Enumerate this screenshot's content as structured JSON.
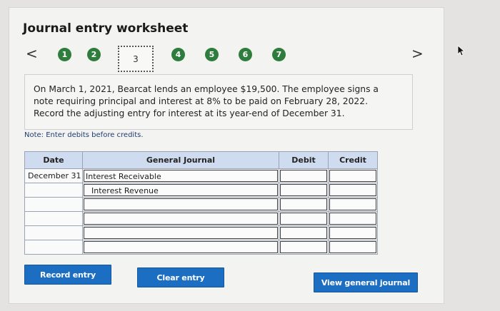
{
  "title": "Journal entry worksheet",
  "nav": {
    "prev_glyph": "<",
    "next_glyph": ">",
    "steps": [
      "1",
      "2",
      "3",
      "4",
      "5",
      "6",
      "7"
    ],
    "current_step": "3"
  },
  "question": {
    "lines": [
      "On March 1, 2021, Bearcat lends an employee $19,500. The employee signs a",
      "note requiring principal and interest at 8% to be paid on February 28, 2022.",
      "Record the adjusting entry for interest at its year-end of December 31."
    ]
  },
  "note": "Note: Enter debits before credits.",
  "journal": {
    "headers": {
      "date": "Date",
      "general_journal": "General Journal",
      "debit": "Debit",
      "credit": "Credit"
    },
    "rows": [
      {
        "date": "December 31",
        "account": "Interest Receivable",
        "debit": "",
        "credit": ""
      },
      {
        "date": "",
        "account": "Interest Revenue",
        "debit": "",
        "credit": ""
      },
      {
        "date": "",
        "account": "",
        "debit": "",
        "credit": ""
      },
      {
        "date": "",
        "account": "",
        "debit": "",
        "credit": ""
      },
      {
        "date": "",
        "account": "",
        "debit": "",
        "credit": ""
      },
      {
        "date": "",
        "account": "",
        "debit": "",
        "credit": ""
      }
    ]
  },
  "buttons": {
    "record": "Record entry",
    "clear": "Clear entry",
    "view": "View general journal"
  },
  "colors": {
    "step_green": "#2e7d3c",
    "button_blue": "#1c6ec2",
    "header_blue": "#cfdcf0"
  }
}
